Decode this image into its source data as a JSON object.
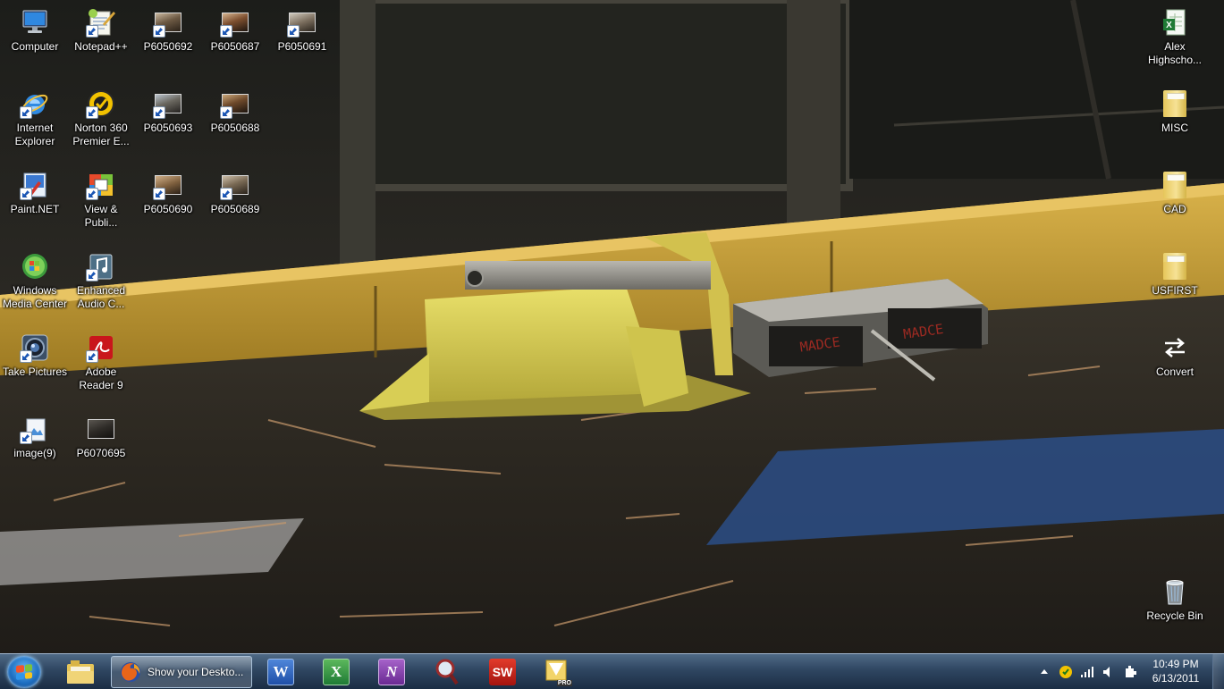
{
  "desktop": {
    "icons_left": [
      {
        "label": "Computer"
      },
      {
        "label": "Notepad++"
      },
      {
        "label": "P6050692"
      },
      {
        "label": "P6050687"
      },
      {
        "label": "P6050691"
      },
      {
        "label": "Internet Explorer"
      },
      {
        "label": "Norton 360 Premier E..."
      },
      {
        "label": "P6050693"
      },
      {
        "label": "P6050688"
      },
      {
        "label": "Paint.NET"
      },
      {
        "label": "View & Publi..."
      },
      {
        "label": "P6050690"
      },
      {
        "label": "P6050689"
      },
      {
        "label": "Windows Media Center"
      },
      {
        "label": "Enhanced Audio C..."
      },
      {
        "label": "Take Pictures"
      },
      {
        "label": "Adobe Reader 9"
      },
      {
        "label": "image(9)"
      },
      {
        "label": "P6070695"
      }
    ],
    "icons_right": [
      {
        "label": "Alex Highscho..."
      },
      {
        "label": "MISC"
      },
      {
        "label": "CAD"
      },
      {
        "label": "USFIRST"
      },
      {
        "label": "Convert"
      },
      {
        "label": "Recycle Bin"
      }
    ]
  },
  "taskbar": {
    "start_label": "Start",
    "firefox_window_title": "Show your Deskto...",
    "pinned_apps": [
      "Windows Explorer",
      "Firefox",
      "Microsoft Word",
      "Microsoft Excel",
      "Microsoft OneNote",
      "Search",
      "SolidWorks",
      "Office PRO"
    ],
    "pro_badge": "PRO"
  },
  "tray": {
    "time": "10:49 PM",
    "date": "6/13/2011"
  },
  "wallpaper": {
    "robot_label_1": "MADCE",
    "robot_label_2": "MADCE"
  }
}
